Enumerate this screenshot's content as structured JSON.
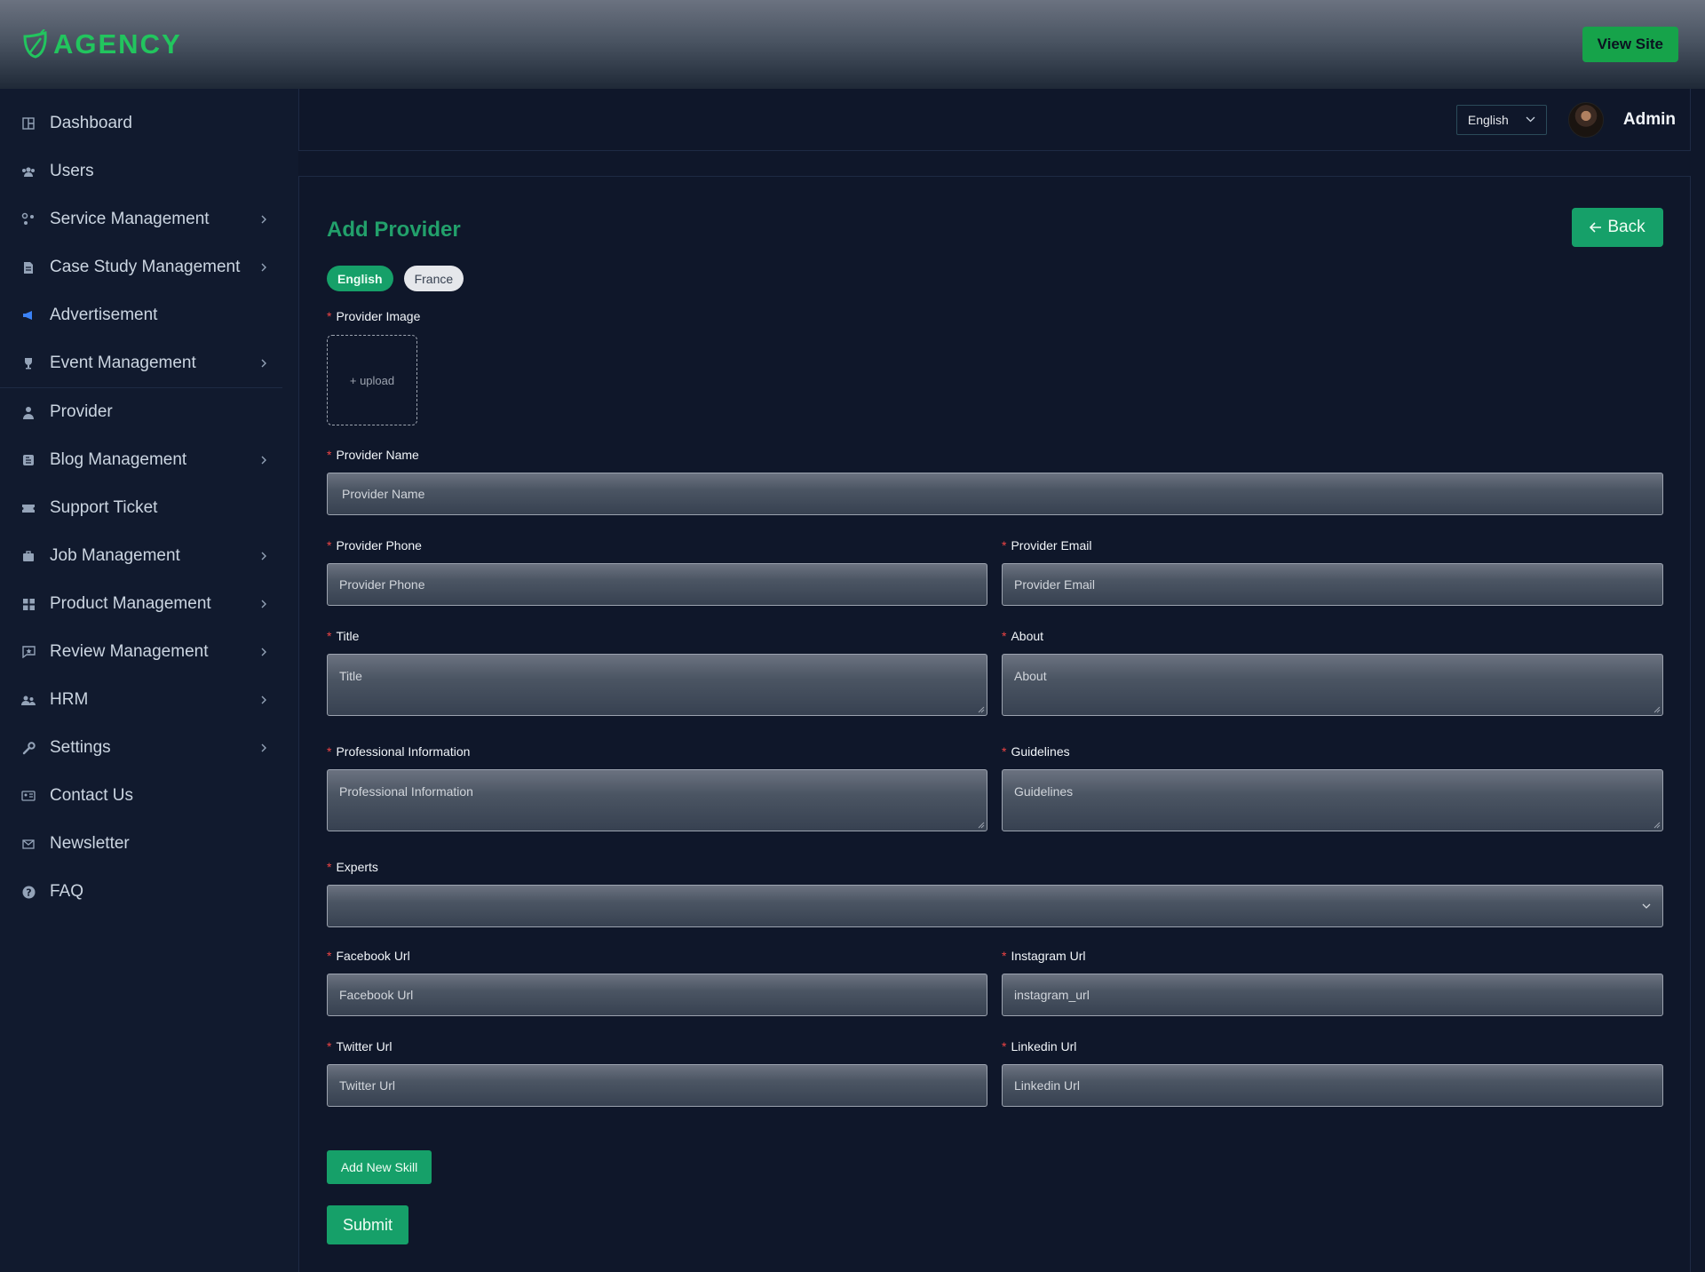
{
  "brand": {
    "name": "AGENCY",
    "color": "#22c55e"
  },
  "topbar": {
    "view_site_label": "View Site"
  },
  "sidebar": {
    "items": [
      {
        "label": "Dashboard",
        "icon": "dashboard-icon",
        "has_submenu": false
      },
      {
        "label": "Users",
        "icon": "users-icon",
        "has_submenu": false
      },
      {
        "label": "Service Management",
        "icon": "services-icon",
        "has_submenu": true
      },
      {
        "label": "Case Study Management",
        "icon": "document-icon",
        "has_submenu": true
      },
      {
        "label": "Advertisement",
        "icon": "megaphone-icon",
        "has_submenu": false
      },
      {
        "label": "Event Management",
        "icon": "trophy-icon",
        "has_submenu": true
      },
      {
        "label": "Provider",
        "icon": "person-icon",
        "has_submenu": false
      },
      {
        "label": "Blog Management",
        "icon": "blog-icon",
        "has_submenu": true
      },
      {
        "label": "Support Ticket",
        "icon": "ticket-icon",
        "has_submenu": false
      },
      {
        "label": "Job Management",
        "icon": "briefcase-icon",
        "has_submenu": true
      },
      {
        "label": "Product Management",
        "icon": "grid-icon",
        "has_submenu": true
      },
      {
        "label": "Review Management",
        "icon": "review-icon",
        "has_submenu": true
      },
      {
        "label": "HRM",
        "icon": "team-icon",
        "has_submenu": true
      },
      {
        "label": "Settings",
        "icon": "wrench-icon",
        "has_submenu": true
      },
      {
        "label": "Contact Us",
        "icon": "contact-card-icon",
        "has_submenu": false
      },
      {
        "label": "Newsletter",
        "icon": "mail-icon",
        "has_submenu": false
      },
      {
        "label": "FAQ",
        "icon": "question-icon",
        "has_submenu": false
      }
    ]
  },
  "header": {
    "language": "English",
    "user_name": "Admin"
  },
  "page": {
    "title": "Add Provider",
    "back_label": "Back",
    "lang_tabs": [
      "English",
      "France"
    ],
    "provider_image_label": "Provider Image",
    "upload_label": "+ upload",
    "fields": {
      "provider_name": {
        "label": "Provider Name",
        "placeholder": "Provider Name"
      },
      "provider_phone": {
        "label": "Provider Phone",
        "placeholder": "Provider Phone"
      },
      "provider_email": {
        "label": "Provider Email",
        "placeholder": "Provider Email"
      },
      "title": {
        "label": "Title",
        "placeholder": "Title"
      },
      "about": {
        "label": "About",
        "placeholder": "About"
      },
      "professional_information": {
        "label": "Professional Information",
        "placeholder": "Professional Information"
      },
      "guidelines": {
        "label": "Guidelines",
        "placeholder": "Guidelines"
      },
      "experts": {
        "label": "Experts",
        "value": ""
      },
      "facebook_url": {
        "label": "Facebook Url",
        "placeholder": "Facebook Url"
      },
      "instagram_url": {
        "label": "Instagram Url",
        "placeholder": "instagram_url"
      },
      "twitter_url": {
        "label": "Twitter Url",
        "placeholder": "Twitter Url"
      },
      "linkedin_url": {
        "label": "Linkedin Url",
        "placeholder": "Linkedin Url"
      }
    },
    "add_skill_label": "Add New Skill",
    "submit_label": "Submit"
  },
  "colors": {
    "accent": "#16a069",
    "background": "#0f172a",
    "required": "#ef4444"
  }
}
